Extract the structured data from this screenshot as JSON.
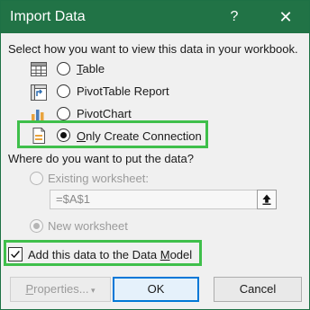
{
  "window": {
    "title": "Import Data",
    "help_glyph": "?",
    "close_glyph": "✕"
  },
  "view_section": {
    "prompt": "Select how you want to view this data in your workbook.",
    "options": [
      {
        "label": "Table",
        "icon": "table-icon",
        "selected": false
      },
      {
        "label": "PivotTable Report",
        "icon": "pivottable-icon",
        "selected": false
      },
      {
        "label": "PivotChart",
        "icon": "pivotchart-icon",
        "selected": false
      },
      {
        "label": "Only Create Connection",
        "icon": "connection-icon",
        "selected": true
      }
    ]
  },
  "location_section": {
    "prompt": "Where do you want to put the data?",
    "existing_label": "Existing worksheet:",
    "existing_value": "=$A$1",
    "new_label": "New worksheet",
    "new_selected": true,
    "enabled": false
  },
  "data_model": {
    "label": "Add this data to the Data Model",
    "checked": true
  },
  "buttons": {
    "properties": "Properties...",
    "ok": "OK",
    "cancel": "Cancel"
  },
  "colors": {
    "titlebar": "#217346",
    "highlight": "#3fbf4b",
    "default_button_border": "#0078d7"
  }
}
